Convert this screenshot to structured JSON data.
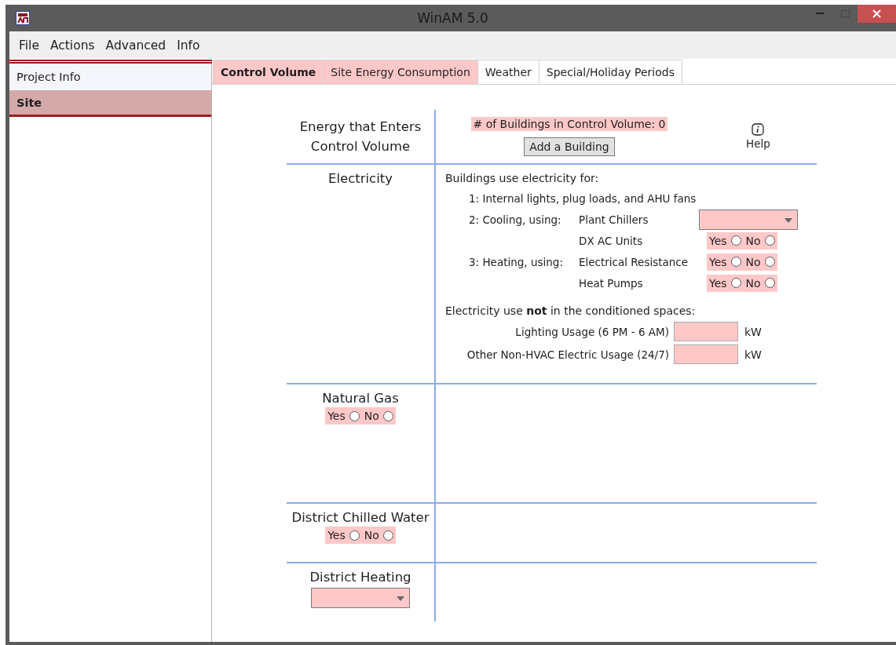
{
  "window": {
    "title": "WinAM 5.0"
  },
  "menu": [
    {
      "label": "File"
    },
    {
      "label": "Actions"
    },
    {
      "label": "Advanced"
    },
    {
      "label": "Info"
    }
  ],
  "sidebar": {
    "items": [
      {
        "label": "Project Info",
        "selected": false
      },
      {
        "label": "Site",
        "selected": true
      }
    ]
  },
  "tabs": [
    {
      "label": "Control Volume",
      "selected": true,
      "flagged": true
    },
    {
      "label": "Site Energy Consumption",
      "selected": false,
      "flagged": true
    },
    {
      "label": "Weather",
      "selected": false,
      "flagged": false
    },
    {
      "label": "Special/Holiday Periods",
      "selected": false,
      "flagged": false
    }
  ],
  "header": {
    "title": "Energy that Enters Control Volume",
    "building_count": "# of Buildings in Control Volume: 0",
    "add_button": "Add a Building",
    "help": "Help"
  },
  "electricity": {
    "label": "Electricity",
    "intro": "Buildings use electricity for:",
    "rows": [
      {
        "kind": "text",
        "category": "1: Internal lights, plug loads, and AHU fans"
      },
      {
        "kind": "dropdown",
        "category": "2: Cooling, using:",
        "item": "Plant Chillers"
      },
      {
        "kind": "radio",
        "item": "DX AC Units",
        "options": [
          {
            "label": "Yes",
            "selected": false
          },
          {
            "label": "No",
            "selected": false
          }
        ]
      },
      {
        "kind": "radio",
        "category": "3: Heating, using:",
        "item": "Electrical Resistance",
        "options": [
          {
            "label": "Yes",
            "selected": false
          },
          {
            "label": "No",
            "selected": false
          }
        ]
      },
      {
        "kind": "radio",
        "item": "Heat Pumps",
        "options": [
          {
            "label": "Yes",
            "selected": false
          },
          {
            "label": "No",
            "selected": false
          }
        ]
      }
    ],
    "other_heading": "Electricity use **not** in the conditioned spaces:",
    "other_usage": [
      {
        "label": "Lighting Usage (6 PM - 6 AM)",
        "unit": "kW"
      },
      {
        "label": "Other Non-HVAC Electric Usage (24/7)",
        "unit": "kW"
      }
    ]
  },
  "sources": [
    {
      "label": "Natural Gas",
      "kind": "radio",
      "options": [
        {
          "label": "Yes",
          "selected": false
        },
        {
          "label": "No",
          "selected": false
        }
      ]
    },
    {
      "label": "District Chilled Water",
      "kind": "radio",
      "options": [
        {
          "label": "Yes",
          "selected": false
        },
        {
          "label": "No",
          "selected": false
        }
      ]
    },
    {
      "label": "District Heating",
      "kind": "dropdown"
    }
  ]
}
